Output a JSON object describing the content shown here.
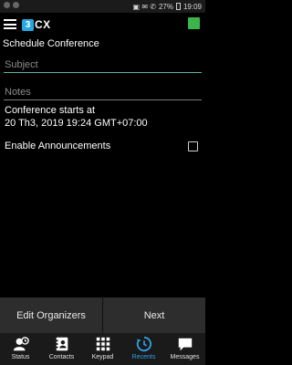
{
  "status_bar": {
    "indicators": "▣ ✉ ✆",
    "battery": "27%",
    "time": "19:09"
  },
  "header": {
    "logo_badge": "3",
    "logo_text": "CX"
  },
  "page_title": "Schedule Conference",
  "form": {
    "subject_placeholder": "Subject",
    "notes_placeholder": "Notes"
  },
  "start_info": {
    "label": "Conference starts at",
    "value": "20 Th3, 2019 19:24 GMT+07:00"
  },
  "announcements": {
    "label": "Enable Announcements",
    "checked": false
  },
  "actions": {
    "edit_organizers": "Edit Organizers",
    "next": "Next"
  },
  "tabs": [
    {
      "label": "Status",
      "icon": "status-icon"
    },
    {
      "label": "Contacts",
      "icon": "contacts-icon"
    },
    {
      "label": "Keypad",
      "icon": "keypad-icon"
    },
    {
      "label": "Recents",
      "icon": "recents-icon",
      "active": true
    },
    {
      "label": "Messages",
      "icon": "messages-icon"
    }
  ],
  "colors": {
    "accent": "#2ea3e6",
    "presence": "#3bb54a",
    "field_underline": "#5bb5a8"
  }
}
